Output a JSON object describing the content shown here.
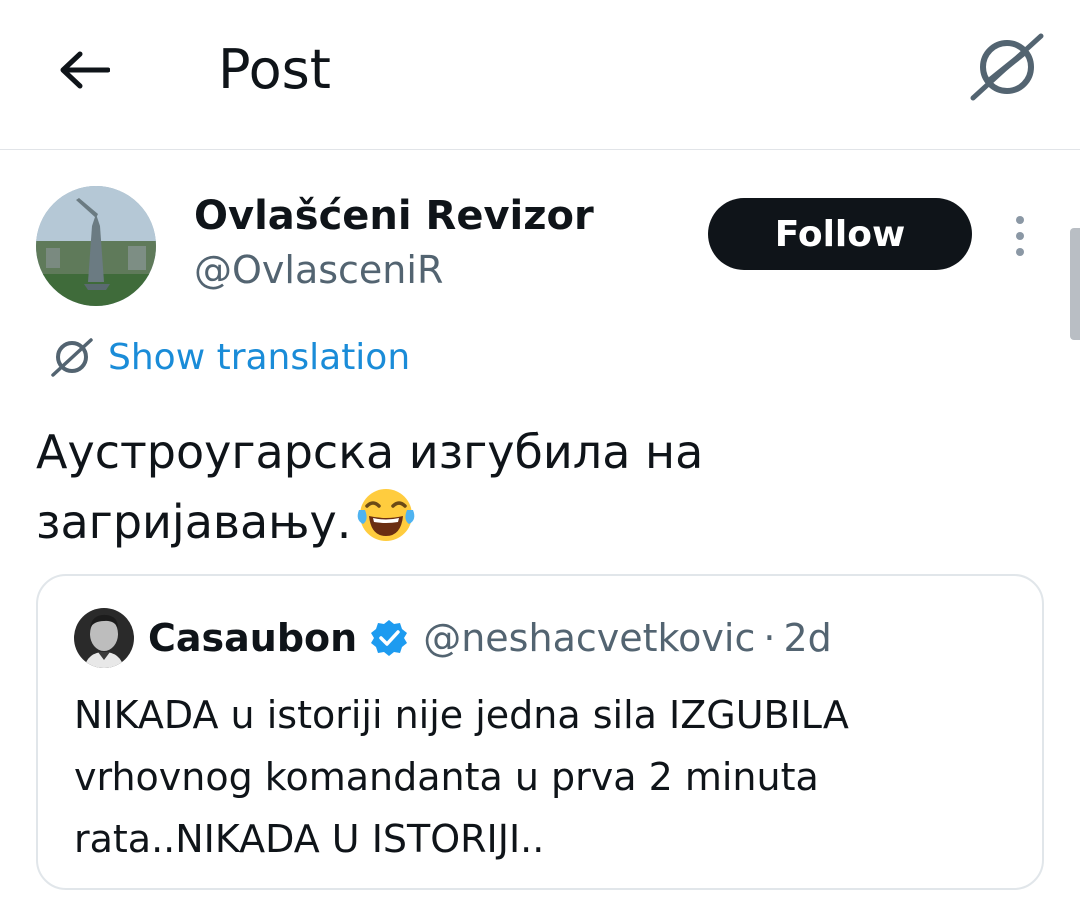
{
  "header": {
    "title": "Post",
    "back_icon": "arrow-left-icon",
    "translate_icon": "translate-globe-icon"
  },
  "author": {
    "display_name": "Ovlašćeni Revizor",
    "handle": "@OvlasceniR",
    "follow_label": "Follow",
    "more_icon": "more-vertical-icon"
  },
  "translation": {
    "label": "Show translation"
  },
  "post": {
    "lines": [
      "Аустроугарска изгубила на",
      "загријавању."
    ],
    "emoji": "face-with-tears-of-joy"
  },
  "quote": {
    "display_name": "Casaubon",
    "verified": true,
    "handle": "@neshacvetkovic",
    "separator": "·",
    "time": "2d",
    "lines": [
      "NIKADA u istoriji nije jedna sila IZGUBILA",
      "vrhovnog komandanta u prva 2 minuta",
      "rata..NIKADA U ISTORIJI.."
    ]
  },
  "colors": {
    "link": "#1a8cd8",
    "secondary_text": "#536471",
    "follow_bg": "#0f1419",
    "verified": "#1d9bf0"
  }
}
